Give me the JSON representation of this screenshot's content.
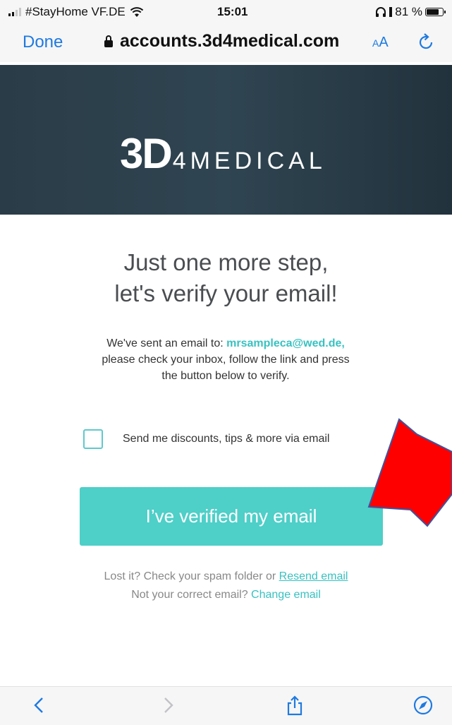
{
  "status_bar": {
    "carrier": "#StayHome VF.DE",
    "time": "15:01",
    "battery_text": "81 %",
    "battery_level": 0.81
  },
  "browser": {
    "done_label": "Done",
    "url": "accounts.3d4medical.com",
    "text_size_small": "A",
    "text_size_large": "A",
    "icons": [
      "lock-icon",
      "reload-icon",
      "back-icon",
      "forward-icon",
      "share-icon",
      "compass-icon"
    ]
  },
  "brand": {
    "logo_main": "3D",
    "logo_rest": "4MEDICAL"
  },
  "page": {
    "headline_line1": "Just one more step,",
    "headline_line2": "let's verify your email!",
    "intro_prefix": "We've sent an email to: ",
    "email": "mrsampleca@wed.de,",
    "intro_line2": "please check your inbox, follow the link and press",
    "intro_line3": "the button below to verify.",
    "checkbox_label": "Send me discounts, tips & more via email",
    "checkbox_checked": false,
    "verify_button": "I’ve verified my email",
    "lost_prefix": "Lost it? Check your spam folder or ",
    "resend_link": "Resend email",
    "wrong_prefix": "Not your correct email? ",
    "change_link": "Change email"
  },
  "colors": {
    "accent": "#4ecfc8",
    "link": "#39c1c1",
    "ios_blue": "#1f7ae0",
    "header_bg": "#2f4551",
    "annotation_arrow": "#ff0000"
  }
}
